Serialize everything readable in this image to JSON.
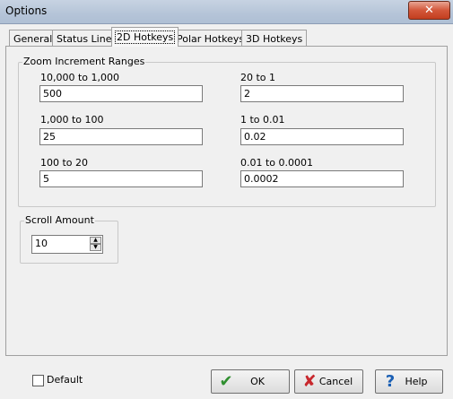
{
  "window": {
    "title": "Options",
    "close_glyph": "✕"
  },
  "tabs": [
    {
      "label": "General"
    },
    {
      "label": "Status Line"
    },
    {
      "label": "2D Hotkeys",
      "active": true
    },
    {
      "label": "Polar Hotkeys"
    },
    {
      "label": "3D Hotkeys"
    }
  ],
  "zoom_group": {
    "title": "Zoom Increment Ranges",
    "fields": [
      {
        "label": "10,000 to 1,000",
        "value": "500"
      },
      {
        "label": "20 to 1",
        "value": "2"
      },
      {
        "label": "1,000 to 100",
        "value": "25"
      },
      {
        "label": "1 to 0.01",
        "value": "0.02"
      },
      {
        "label": "100 to 20",
        "value": "5"
      },
      {
        "label": "0.01 to 0.0001",
        "value": "0.0002"
      }
    ]
  },
  "scroll_group": {
    "title": "Scroll Amount",
    "value": "10"
  },
  "footer": {
    "default_label": "Default",
    "default_checked": false,
    "ok_label": "OK",
    "cancel_label": "Cancel",
    "help_label": "Help"
  },
  "colors": {
    "ok_check": "#2f8f2f",
    "cancel_x": "#c8282d",
    "help_q": "#1a5fb4"
  },
  "icons": {
    "ok": "checkmark-icon",
    "cancel": "x-mark-icon",
    "help": "question-mark-icon"
  }
}
